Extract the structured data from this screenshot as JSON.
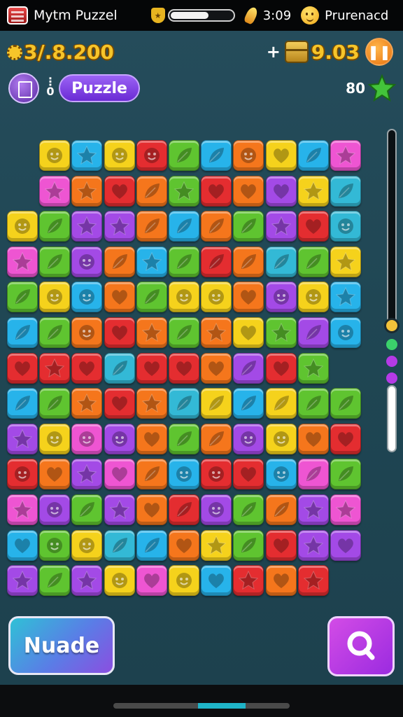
{
  "status_bar": {
    "app_title": "Mytm Puzzel",
    "clock": "3:09",
    "progress_fraction": 0.62,
    "premium_label": "Prurenacd"
  },
  "hud": {
    "score": "3/.8.200",
    "plus": "+",
    "coin_value": "9.03",
    "moves": "0",
    "puzzle_label": "Puzzle",
    "star_count": "80"
  },
  "colors": {
    "Y": "#f5d21c",
    "B": "#27b3ea",
    "R": "#e42d30",
    "G": "#5fc430",
    "P": "#a34ae6",
    "K": "#ee55d2",
    "O": "#f5761c",
    "M": "#33b9d6"
  },
  "board": {
    "rows": [
      "-YBYRGBOYBK",
      "-KOROGROPYM",
      "YGPPOBOGPRM",
      "KGPOBGROMGY",
      "GYBOGYYOPYB",
      "BGOROGOYGPB",
      "RRRMRROPRG",
      "BGOROMYBYGG",
      "PYKPOGOPYOR",
      "ROPKOBRRBKG",
      "KPGPORPGOPK",
      "BGYMBOYGRPP",
      "PGPYKYBROR"
    ],
    "icons": [
      "-FSFFLLFHLS",
      "-SSHLSHHHSL",
      "FLSSLLLLSHF",
      "SLFLSLLLLLS",
      "LFFHLFFHFF",
      "LLFHSLSHSLF",
      "HSHLHHHLHSL",
      "LLSHSLLLLLL",
      "SFFFHLLFFHH",
      "FHSHLFFHFLL",
      "SFLSHLFLLSS",
      "HFFLLHSLHSH",
      "SLSFHFHSHSF"
    ]
  },
  "buttons": {
    "left_label": "Nuade",
    "right_icon": "search-magnifier-icon"
  }
}
